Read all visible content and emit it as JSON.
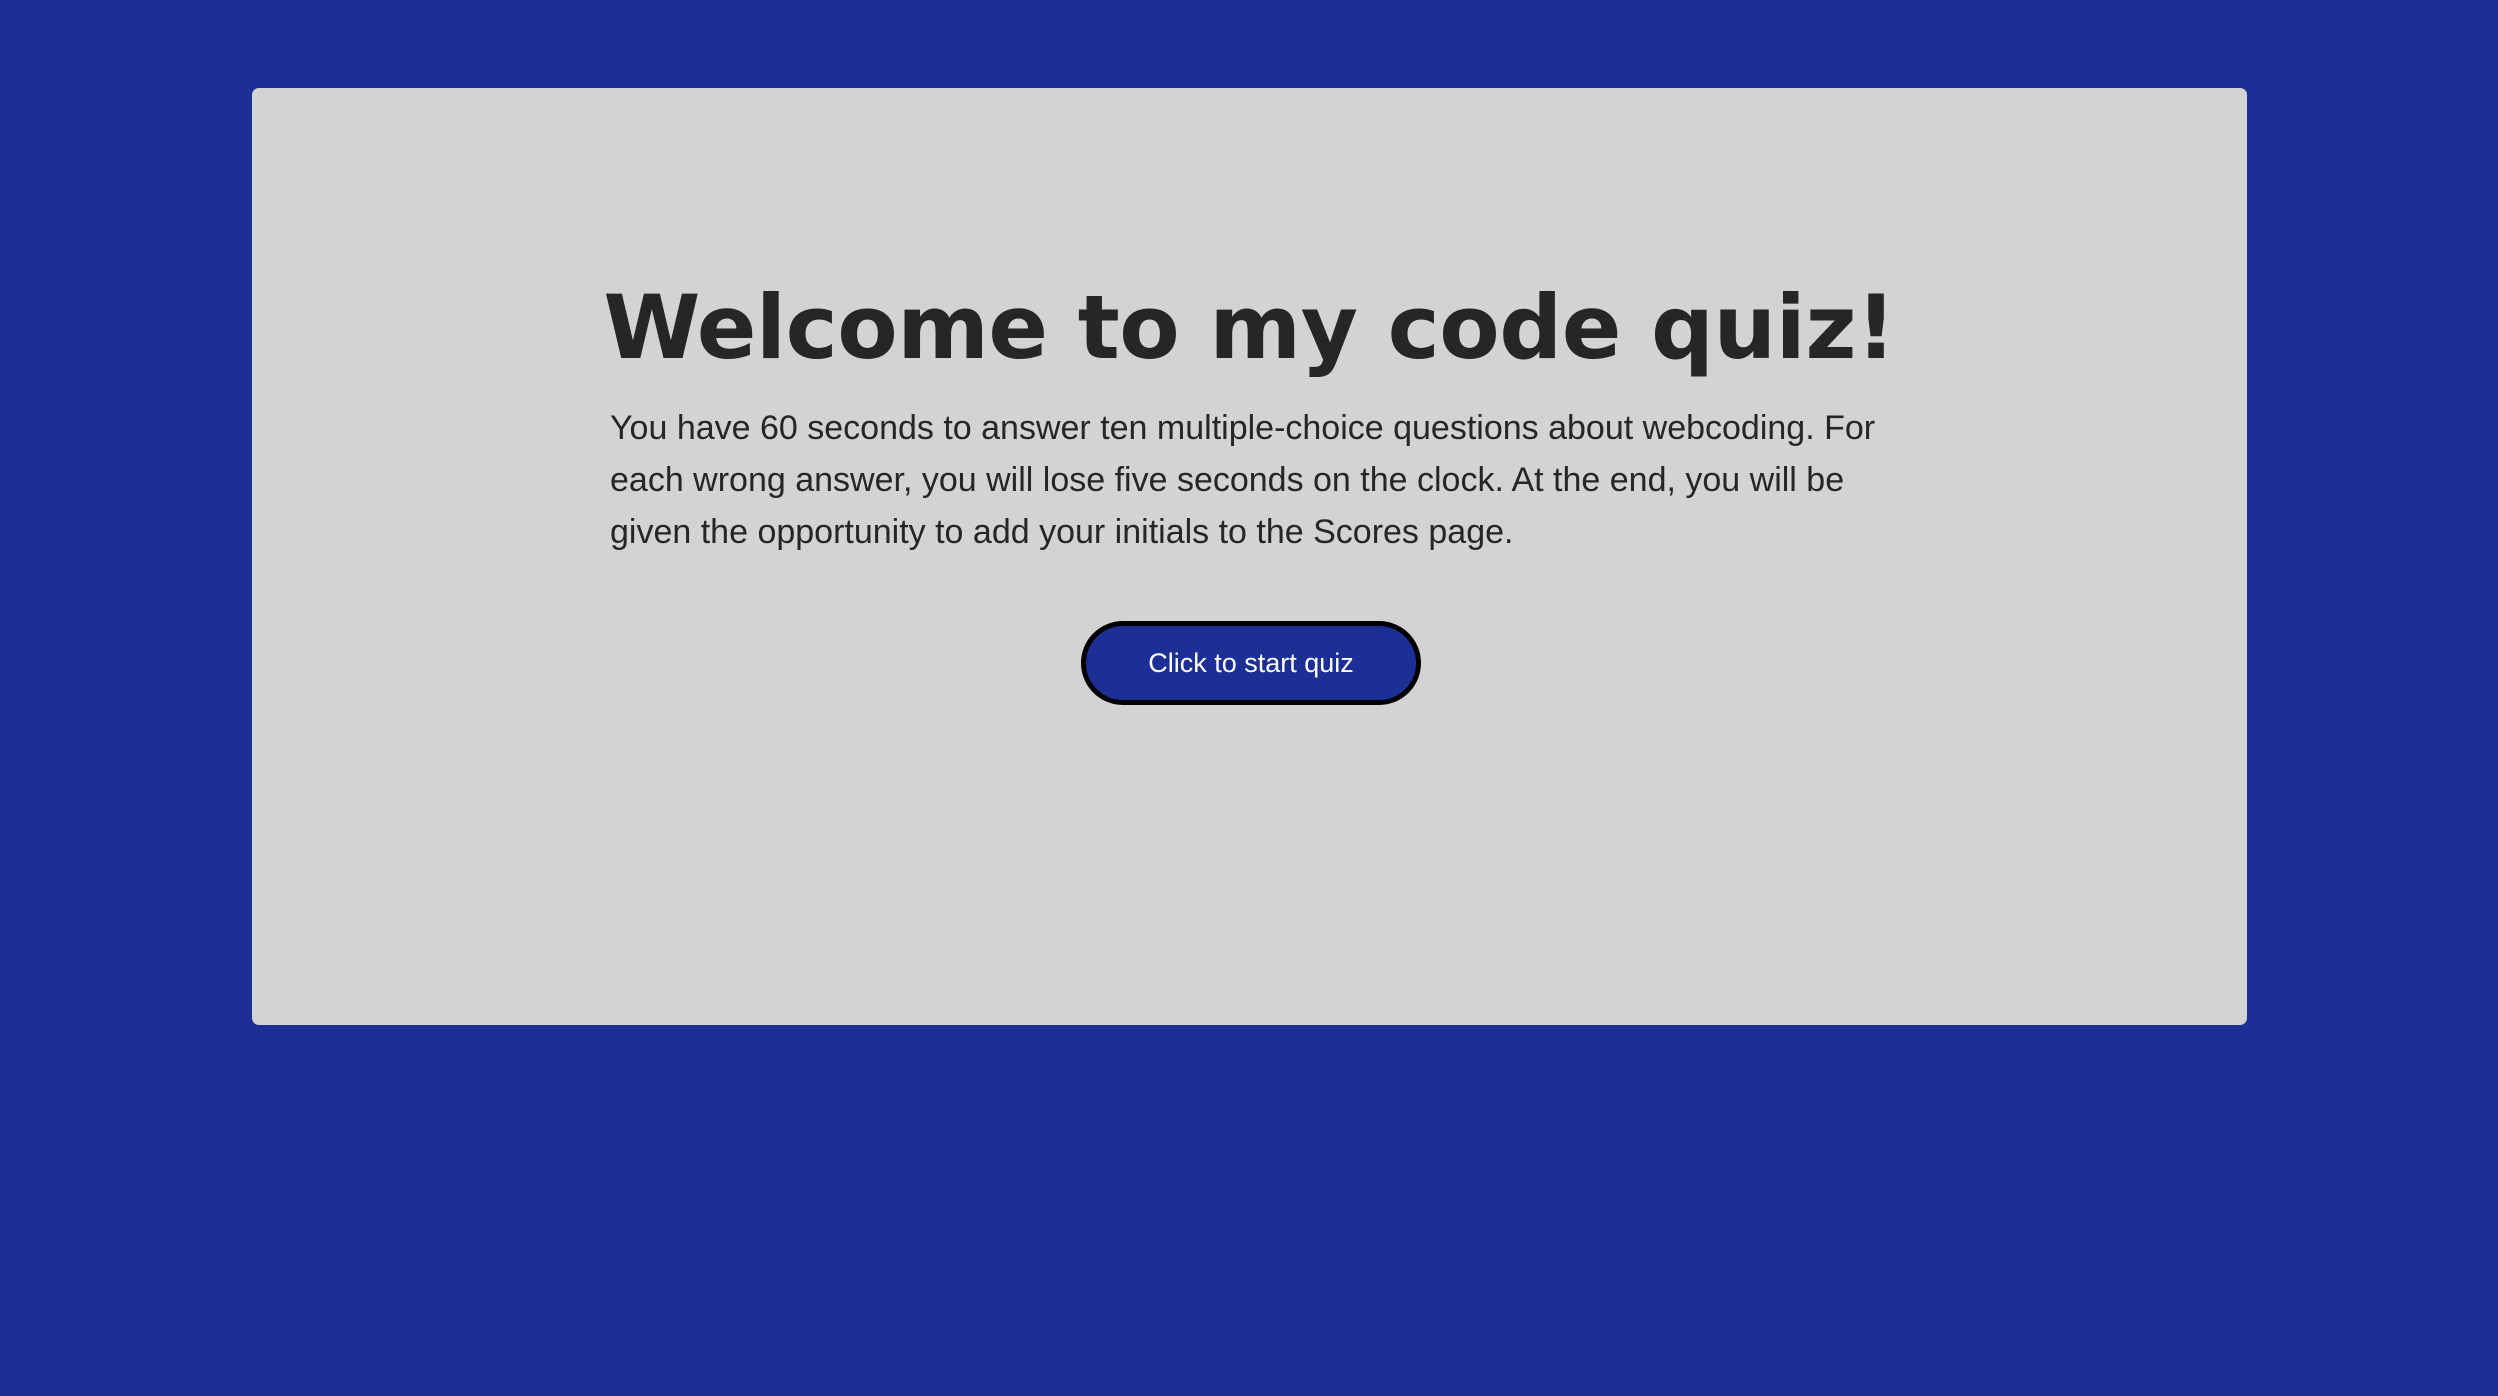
{
  "page": {
    "background_color": "#1b2f95"
  },
  "card": {
    "background_color": "#d3d3d3",
    "title": "Welcome to my code quiz!",
    "intro": "You have 60 seconds to answer ten multiple-choice questions about webcoding. For each wrong answer, you will lose five seconds on the clock. At the end, you will be given the opportunity to add your initials to the Scores page.",
    "start_button_label": "Click to start quiz",
    "button_color": "#1b2f95",
    "button_text_color": "#ffffff"
  }
}
